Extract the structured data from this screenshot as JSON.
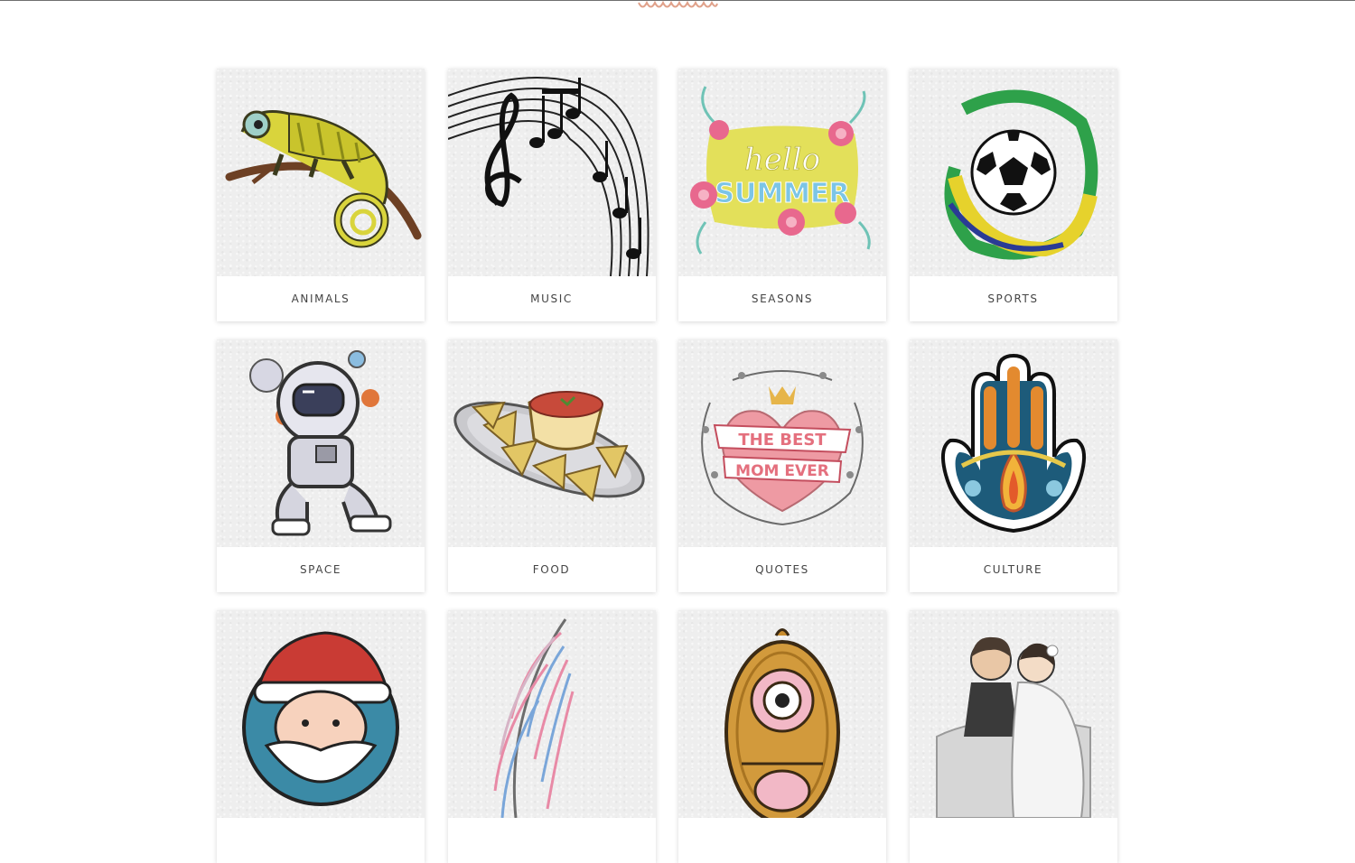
{
  "theme": {
    "accent": "#e0a18a",
    "label_color": "#444444",
    "card_bg": "#ffffff",
    "thumb_bg": "#eeeeee"
  },
  "header": {
    "divider_icon": "zigzag-ornament-icon"
  },
  "categories": [
    {
      "label": "ANIMALS",
      "icon": "chameleon-icon"
    },
    {
      "label": "MUSIC",
      "icon": "music-notes-icon"
    },
    {
      "label": "SEASONS",
      "icon": "hello-summer-icon",
      "artwork_text": [
        "hello",
        "SUMMER"
      ]
    },
    {
      "label": "SPORTS",
      "icon": "soccer-ball-icon"
    },
    {
      "label": "SPACE",
      "icon": "astronaut-icon"
    },
    {
      "label": "FOOD",
      "icon": "nachos-icon"
    },
    {
      "label": "QUOTES",
      "icon": "best-mom-heart-icon",
      "artwork_text": [
        "THE BEST",
        "MOM EVER"
      ]
    },
    {
      "label": "CULTURE",
      "icon": "hamsa-hand-icon"
    },
    {
      "label": "",
      "icon": "santa-claus-icon"
    },
    {
      "label": "",
      "icon": "feather-icon"
    },
    {
      "label": "",
      "icon": "monster-icon"
    },
    {
      "label": "",
      "icon": "wedding-couple-icon"
    }
  ]
}
